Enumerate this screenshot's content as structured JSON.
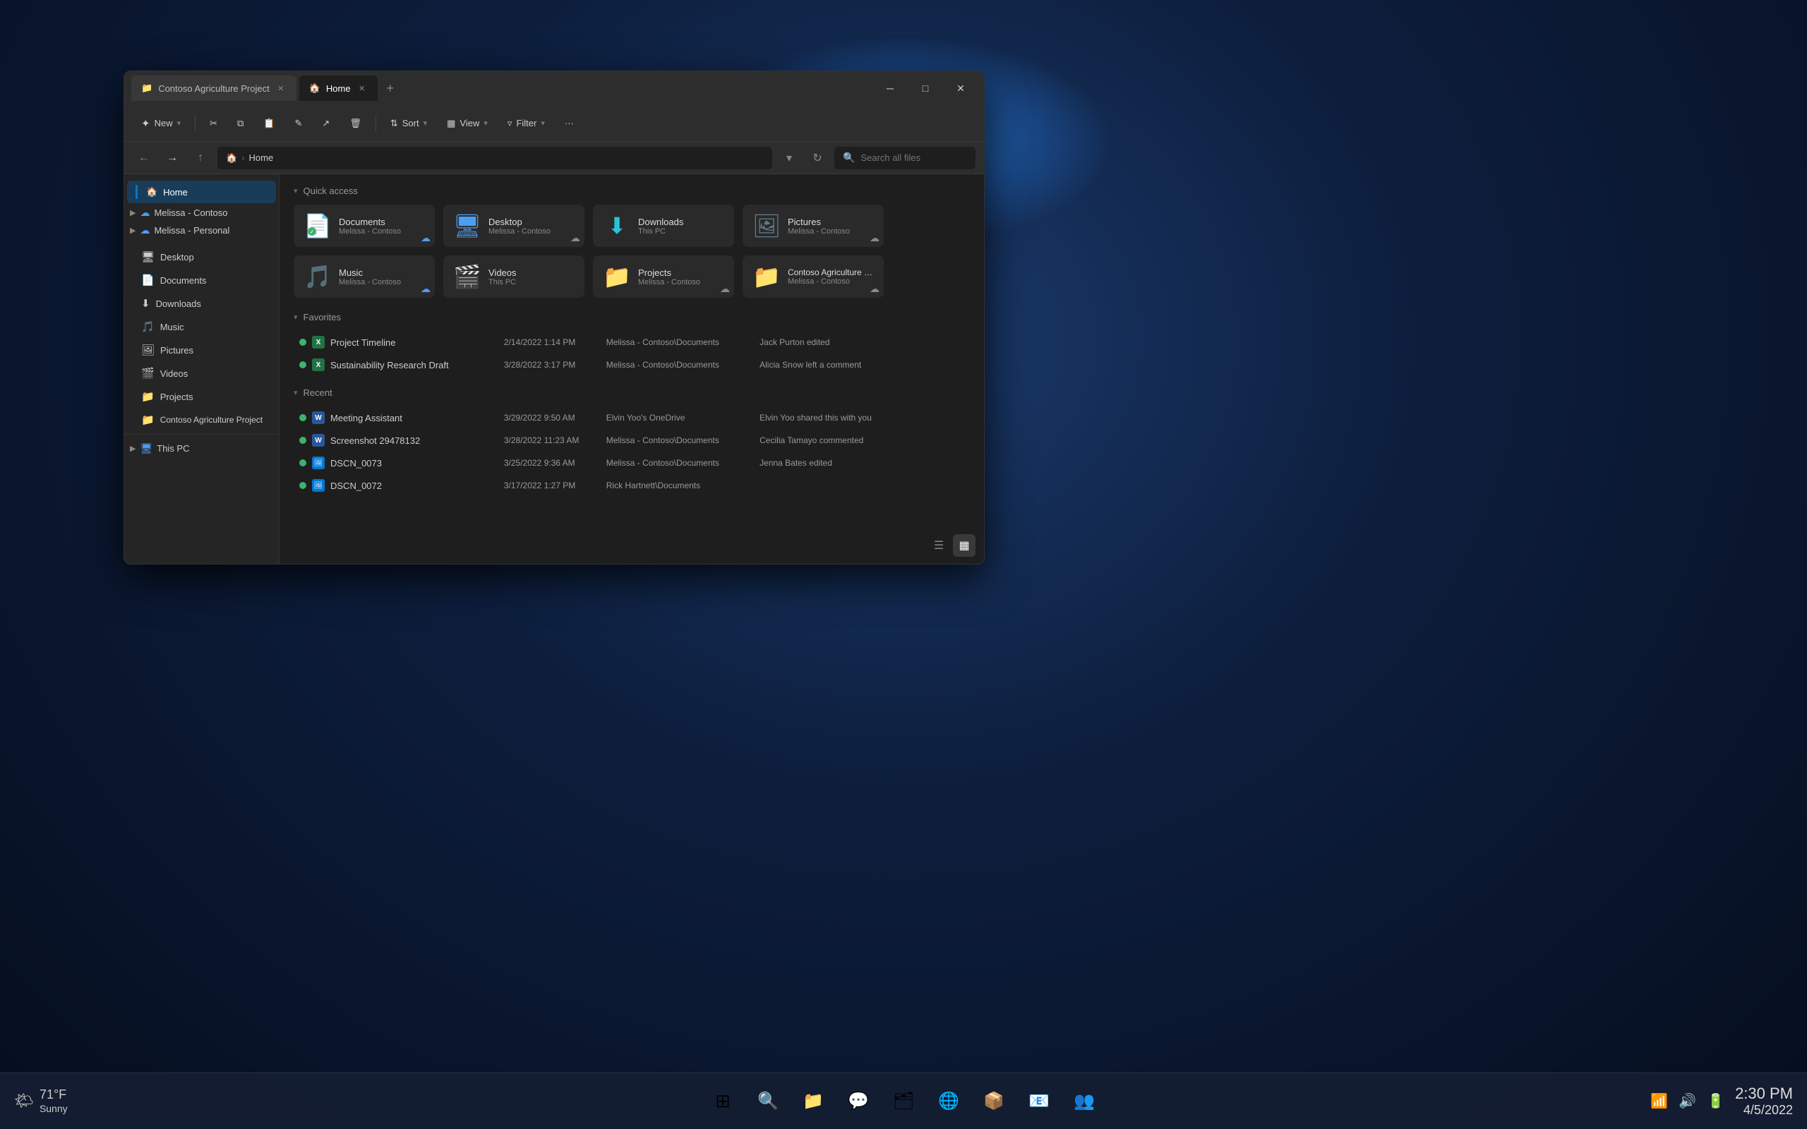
{
  "desktop": {
    "bg_color": "#0a1628"
  },
  "taskbar": {
    "weather_temp": "71°F",
    "weather_desc": "Sunny",
    "time": "2:30 PM",
    "date": "4/5/2022",
    "icons": [
      {
        "name": "start",
        "symbol": "⊞",
        "id": "start"
      },
      {
        "name": "search",
        "symbol": "🔍",
        "id": "search"
      },
      {
        "name": "file-explorer",
        "symbol": "📁",
        "id": "file-explorer"
      },
      {
        "name": "chat",
        "symbol": "💬",
        "id": "chat"
      },
      {
        "name": "folder2",
        "symbol": "🗂",
        "id": "folder2"
      },
      {
        "name": "edge",
        "symbol": "🌐",
        "id": "edge"
      },
      {
        "name": "app1",
        "symbol": "📦",
        "id": "app1"
      },
      {
        "name": "outlook",
        "symbol": "📧",
        "id": "outlook"
      },
      {
        "name": "teams",
        "symbol": "👥",
        "id": "teams"
      }
    ],
    "sys_icons": [
      "🔊",
      "📶",
      "🔋"
    ]
  },
  "window": {
    "tabs": [
      {
        "label": "Contoso Agriculture Project",
        "active": false,
        "icon": "📁"
      },
      {
        "label": "Home",
        "active": true,
        "icon": "🏠"
      }
    ],
    "toolbar": {
      "new_label": "New",
      "cut_tooltip": "Cut",
      "copy_tooltip": "Copy",
      "paste_tooltip": "Paste",
      "rename_tooltip": "Rename",
      "delete_tooltip": "Delete",
      "sort_label": "Sort",
      "view_label": "View",
      "filter_label": "Filter",
      "more_label": "···"
    },
    "address": {
      "home_icon": "🏠",
      "path": "Home",
      "search_placeholder": "Search all files"
    },
    "sidebar": {
      "home_label": "Home",
      "cloud_accounts": [
        {
          "label": "Melissa - Contoso",
          "expanded": true
        },
        {
          "label": "Melissa - Personal",
          "expanded": false
        }
      ],
      "pinned_folders": [
        {
          "label": "Desktop",
          "icon": "🖥",
          "pinned": true
        },
        {
          "label": "Documents",
          "icon": "📄",
          "pinned": true
        },
        {
          "label": "Downloads",
          "icon": "⬇",
          "pinned": true
        },
        {
          "label": "Music",
          "icon": "🎵",
          "pinned": true
        },
        {
          "label": "Pictures",
          "icon": "🖼",
          "pinned": true
        },
        {
          "label": "Videos",
          "icon": "🎬",
          "pinned": true
        },
        {
          "label": "Projects",
          "icon": "📁",
          "pinned": true
        },
        {
          "label": "Contoso Agriculture Project",
          "icon": "📁"
        }
      ],
      "this_pc": {
        "label": "This PC",
        "expanded": false
      }
    },
    "content": {
      "quick_access_label": "Quick access",
      "favorites_label": "Favorites",
      "recent_label": "Recent",
      "quick_access_folders": [
        {
          "name": "Documents",
          "sub": "Melissa - Contoso",
          "icon": "📄",
          "color": "#607d8b",
          "synced": true,
          "cloud": true
        },
        {
          "name": "Desktop",
          "sub": "Melissa - Contoso",
          "icon": "🖥",
          "color": "#4a9ef5",
          "synced": false,
          "cloud": true
        },
        {
          "name": "Downloads",
          "sub": "This PC",
          "icon": "⬇",
          "color": "#26c6da",
          "synced": false,
          "cloud": false
        },
        {
          "name": "Pictures",
          "sub": "Melissa - Contoso",
          "icon": "🖼",
          "color": "#607d8b",
          "synced": false,
          "cloud": true
        },
        {
          "name": "Music",
          "sub": "Melissa - Contoso",
          "icon": "🎵",
          "color": "#e91e63",
          "synced": false,
          "cloud": true
        },
        {
          "name": "Videos",
          "sub": "This PC",
          "icon": "🎬",
          "color": "#9c27b0",
          "synced": false,
          "cloud": false
        },
        {
          "name": "Projects",
          "sub": "Melissa - Contoso",
          "icon": "📁",
          "color": "#f0b429",
          "synced": false,
          "cloud": true
        },
        {
          "name": "Contoso Agriculture Project",
          "sub": "Melissa - Contoso",
          "icon": "📁",
          "color": "#f0b429",
          "synced": false,
          "cloud": true
        }
      ],
      "favorites_files": [
        {
          "name": "Project Timeline",
          "type": "excel",
          "date": "2/14/2022 1:14 PM",
          "location": "Melissa - Contoso\\Documents",
          "activity": "Jack Purton edited"
        },
        {
          "name": "Sustainability Research Draft",
          "type": "word",
          "date": "3/28/2022 3:17 PM",
          "location": "Melissa - Contoso\\Documents",
          "activity": "Alicia Snow left a comment"
        }
      ],
      "recent_files": [
        {
          "name": "Meeting Assistant",
          "type": "word",
          "date": "3/29/2022 9:50 AM",
          "location": "Elvin Yoo's OneDrive",
          "activity": "Elvin Yoo shared this with you"
        },
        {
          "name": "Screenshot 29478132",
          "type": "word",
          "date": "3/28/2022 11:23 AM",
          "location": "Melissa - Contoso\\Documents",
          "activity": "Cecilia Tamayo commented"
        },
        {
          "name": "DSCN_0073",
          "type": "img",
          "date": "3/25/2022 9:36 AM",
          "location": "Melissa - Contoso\\Documents",
          "activity": "Jenna Bates edited"
        },
        {
          "name": "DSCN_0072",
          "type": "img",
          "date": "3/17/2022 1:27 PM",
          "location": "Rick Hartnett\\Documents",
          "activity": ""
        }
      ]
    }
  }
}
